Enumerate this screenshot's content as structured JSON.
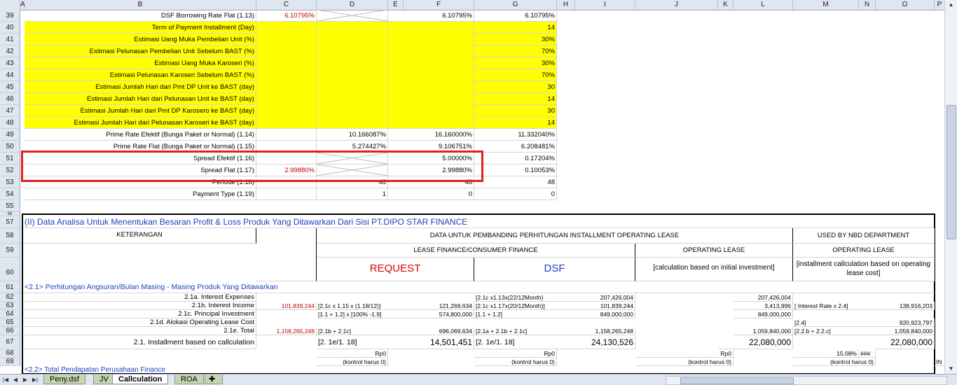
{
  "columns": [
    "A",
    "B",
    "C",
    "D",
    "E",
    "F",
    "G",
    "H",
    "I",
    "J",
    "K",
    "L",
    "M",
    "N",
    "O",
    "P"
  ],
  "rows": [
    "39",
    "40",
    "41",
    "42",
    "43",
    "44",
    "45",
    "46",
    "47",
    "48",
    "49",
    "50",
    "51",
    "52",
    "53",
    "54",
    "55",
    "56",
    "57",
    "58",
    "59",
    "60",
    "61",
    "62",
    "63",
    "64",
    "65",
    "66",
    "67",
    "68",
    "69"
  ],
  "r39": {
    "b": "DSF Borrowing Rate Flat (1.13)",
    "c": "6.10795%",
    "f": "6.10795%",
    "g": "6.10795%"
  },
  "r40": {
    "b": "Term of Payment Installment (Day)",
    "g": "14"
  },
  "r41": {
    "b": "Estimasi Uang Muka Pembelian Unit (%)",
    "g": "30%"
  },
  "r42": {
    "b": "Estimasi Pelunasan Pembelian Unit Sebelum BAST (%)",
    "g": "70%"
  },
  "r43": {
    "b": "Estimasi Uang Muka Karoseri (%)",
    "g": "30%"
  },
  "r44": {
    "b": "Estimasi Pelunasan Karoseri Sebelum BAST (%)",
    "g": "70%"
  },
  "r45": {
    "b": "Estimasi Jumlah Hari dari Pmt DP Unit ke BAST (day)",
    "g": "30"
  },
  "r46": {
    "b": "Estimasi Jumlah Hari dari Pelunasan Unit ke BAST (day)",
    "g": "14"
  },
  "r47": {
    "b": "Estimasi Jumlah Hari dari Pmt DP Karosero ke BAST (day)",
    "g": "30"
  },
  "r48": {
    "b": "Estimasi Jumlah Hari dari Pelunasan Karoseri ke BAST (day)",
    "g": "14"
  },
  "r49": {
    "b": "Prime Rate Efektif (Bunga Paket or Normal) (1.14)",
    "d": "10.166087%",
    "f": "16.160000%",
    "g": "11.332040%"
  },
  "r50": {
    "b": "Prime Rate Flat (Bunga Paket or Normal) (1.15)",
    "d": "5.274427%",
    "f": "9.106751%",
    "g": "6.208481%"
  },
  "r51": {
    "b": "Spread Efektif (1.16)",
    "f": "5.00000%",
    "g": "0.17204%"
  },
  "r52": {
    "b": "Spread Flat (1.17)",
    "c": "2.99880%",
    "f": "2.99880%",
    "g": "0.10053%"
  },
  "r53": {
    "b": "Periode (1.18)",
    "d": "48",
    "f": "48",
    "g": "48"
  },
  "r54": {
    "b": "Payment Type (1.19)",
    "d": "1",
    "f": "0",
    "g": "0"
  },
  "r57": {
    "title": "(II) Data Analisa Untuk Menentukan Besaran Profit & Loss Produk Yang Ditawarkan Dari Sisi PT.DIPO STAR FINANCE"
  },
  "r58": {
    "keterangan": "KETERANGAN",
    "data_header": "DATA UNTUK PEMBANDING PERHITUNGAN INSTALLMENT OPERATING LEASE",
    "nbd": "USED BY NBD DEPARTMENT"
  },
  "r59": {
    "lease": "LEASE FINANCE/CONSUMER FINANCE",
    "op": "OPERATING LEASE",
    "op2": "OPERATING LEASE"
  },
  "r60": {
    "request": "REQUEST",
    "dsf": "DSF",
    "calc1": "[calculation based on initial investment]",
    "calc2": "[installment callculation based on operating lease cost]"
  },
  "r61": {
    "b": "<2.1> Perhitungan Angsuran/Bulan Masing - Masing Produk Yang Ditawarkan"
  },
  "r62": {
    "b": "2.1a. Interest Expenses",
    "f_note": "[2.1c x1.13x(22/12Month)",
    "f_val": "207,426,004",
    "l": "207,426,004"
  },
  "r63": {
    "b": "2.1b. Interest Income",
    "c": "101,839,244",
    "d_note": "[2.1c x 1.15 x (1.18/12)]",
    "d_val": "121,269,634",
    "f_note": "[2.1c x1.17x(20/12Month)]",
    "f_val": "101,839,244",
    "l": "3,413,996",
    "m_note": "[ Interest Rate x 2.4]",
    "o": "138,916,203"
  },
  "r64": {
    "b": "2.1c. Principal Investment",
    "d_note": "[1.1 + 1.2] x [100% -1.9]",
    "d_val": "574,800,000",
    "f_note": "[1.1 + 1.2]",
    "f_val": "849,000,000",
    "l": "849,000,000"
  },
  "r65": {
    "b": "2.1d. Alokasi Operating Lease Cost",
    "m_note": "[2.4]",
    "o": "920,923,797"
  },
  "r66": {
    "b": "2.1e. Total",
    "c": "1,158,265,248",
    "d_note": "[2.1b + 2.1c]",
    "d_val": "696,069,634",
    "f_note": "[2.1a + 2.1b + 2.1c]",
    "f_val": "1,158,265,248",
    "l": "1,059,840,000",
    "m_note": "[2.2.b + 2.2.c]",
    "o": "1,059,840,000"
  },
  "r67": {
    "b": "2.1. Installment based on callculation",
    "d_note": "[2. 1e/1. 18]",
    "d_val": "14,501,451",
    "f_note": "[2. 1e/1. 18]",
    "f_val": "24,130,526",
    "l": "22,080,000",
    "o": "22,080,000"
  },
  "r68": {
    "d": "Rp0",
    "f": "Rp0",
    "l": "Rp0",
    "m": "15.08%",
    "n": "###"
  },
  "r69": {
    "b": "<2.2> Total Pendapatan Perusahaan Finance",
    "d": "(kontrol harus 0)",
    "f": "(kontrol harus 0)",
    "l": "(kontrol harus 0)",
    "m": "(kontrol harus 0)",
    "p": "IN"
  },
  "tabs": [
    "Peny.dsf",
    "JV",
    "Callculation",
    "ROA"
  ],
  "colors": {
    "yellow": "#ffff00",
    "red_value": "#c00000",
    "blue_text": "#1f3fbf",
    "highlight": "#e02020"
  }
}
